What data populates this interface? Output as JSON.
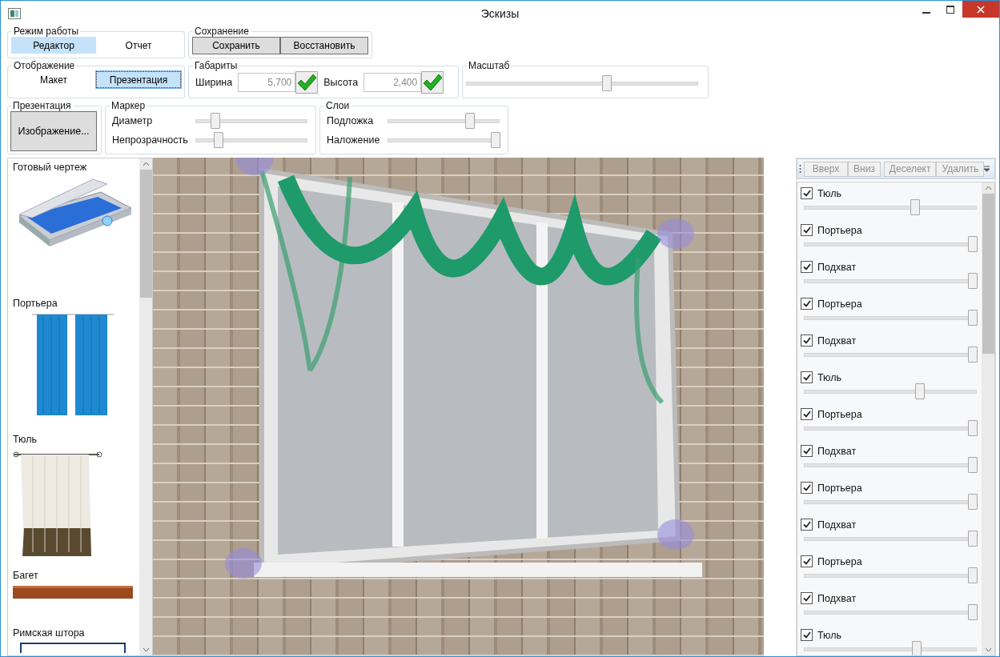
{
  "window": {
    "title": "Эскизы"
  },
  "work_mode": {
    "label": "Режим работы",
    "options": [
      {
        "label": "Редактор",
        "selected": true
      },
      {
        "label": "Отчет",
        "selected": false
      }
    ]
  },
  "saving": {
    "label": "Сохранение",
    "buttons": [
      "Сохранить",
      "Восстановить"
    ]
  },
  "display": {
    "label": "Отображение",
    "options": [
      {
        "label": "Макет",
        "selected": false
      },
      {
        "label": "Презентация",
        "selected": true
      }
    ]
  },
  "dimensions": {
    "label": "Габариты",
    "fields": [
      {
        "label": "Ширина",
        "value": "5,700"
      },
      {
        "label": "Высота",
        "value": "2,400"
      }
    ]
  },
  "scale": {
    "label": "Масштаб",
    "level": 0.61
  },
  "presentation": {
    "label": "Презентация",
    "button": "Изображение..."
  },
  "marker": {
    "label": "Маркер",
    "sliders": [
      {
        "label": "Диаметр",
        "level": 0.15
      },
      {
        "label": "Непрозрачность",
        "level": 0.18
      }
    ]
  },
  "layers": {
    "label": "Слои",
    "sliders": [
      {
        "label": "Подложка",
        "level": 0.75
      },
      {
        "label": "Наложение",
        "level": 1
      }
    ]
  },
  "catalog": [
    {
      "label": "Готовый чертеж",
      "kind": "scanner"
    },
    {
      "label": "Портьера",
      "kind": "curtain"
    },
    {
      "label": "Тюль",
      "kind": "tulle"
    },
    {
      "label": "Багет",
      "kind": "rod"
    },
    {
      "label": "Римская штора",
      "kind": "roman"
    }
  ],
  "layer_toolbar": [
    {
      "label": "Вверх",
      "disabled": true
    },
    {
      "label": "Вниз",
      "disabled": true
    },
    {
      "label": "Деселект",
      "disabled": true
    },
    {
      "label": "Удалить",
      "disabled": true
    }
  ],
  "layer_list": [
    {
      "label": "Тюль",
      "checked": true,
      "level": 0.65
    },
    {
      "label": "Портьера",
      "checked": true,
      "level": 1
    },
    {
      "label": "Подхват",
      "checked": true,
      "level": 1
    },
    {
      "label": "Портьера",
      "checked": true,
      "level": 1
    },
    {
      "label": "Подхват",
      "checked": true,
      "level": 1
    },
    {
      "label": "Тюль",
      "checked": true,
      "level": 0.68
    },
    {
      "label": "Портьера",
      "checked": true,
      "level": 1
    },
    {
      "label": "Подхват",
      "checked": true,
      "level": 1
    },
    {
      "label": "Портьера",
      "checked": true,
      "level": 1
    },
    {
      "label": "Подхват",
      "checked": true,
      "level": 1
    },
    {
      "label": "Портьера",
      "checked": true,
      "level": 1
    },
    {
      "label": "Подхват",
      "checked": true,
      "level": 1
    },
    {
      "label": "Тюль",
      "checked": true,
      "level": 0.66
    }
  ]
}
